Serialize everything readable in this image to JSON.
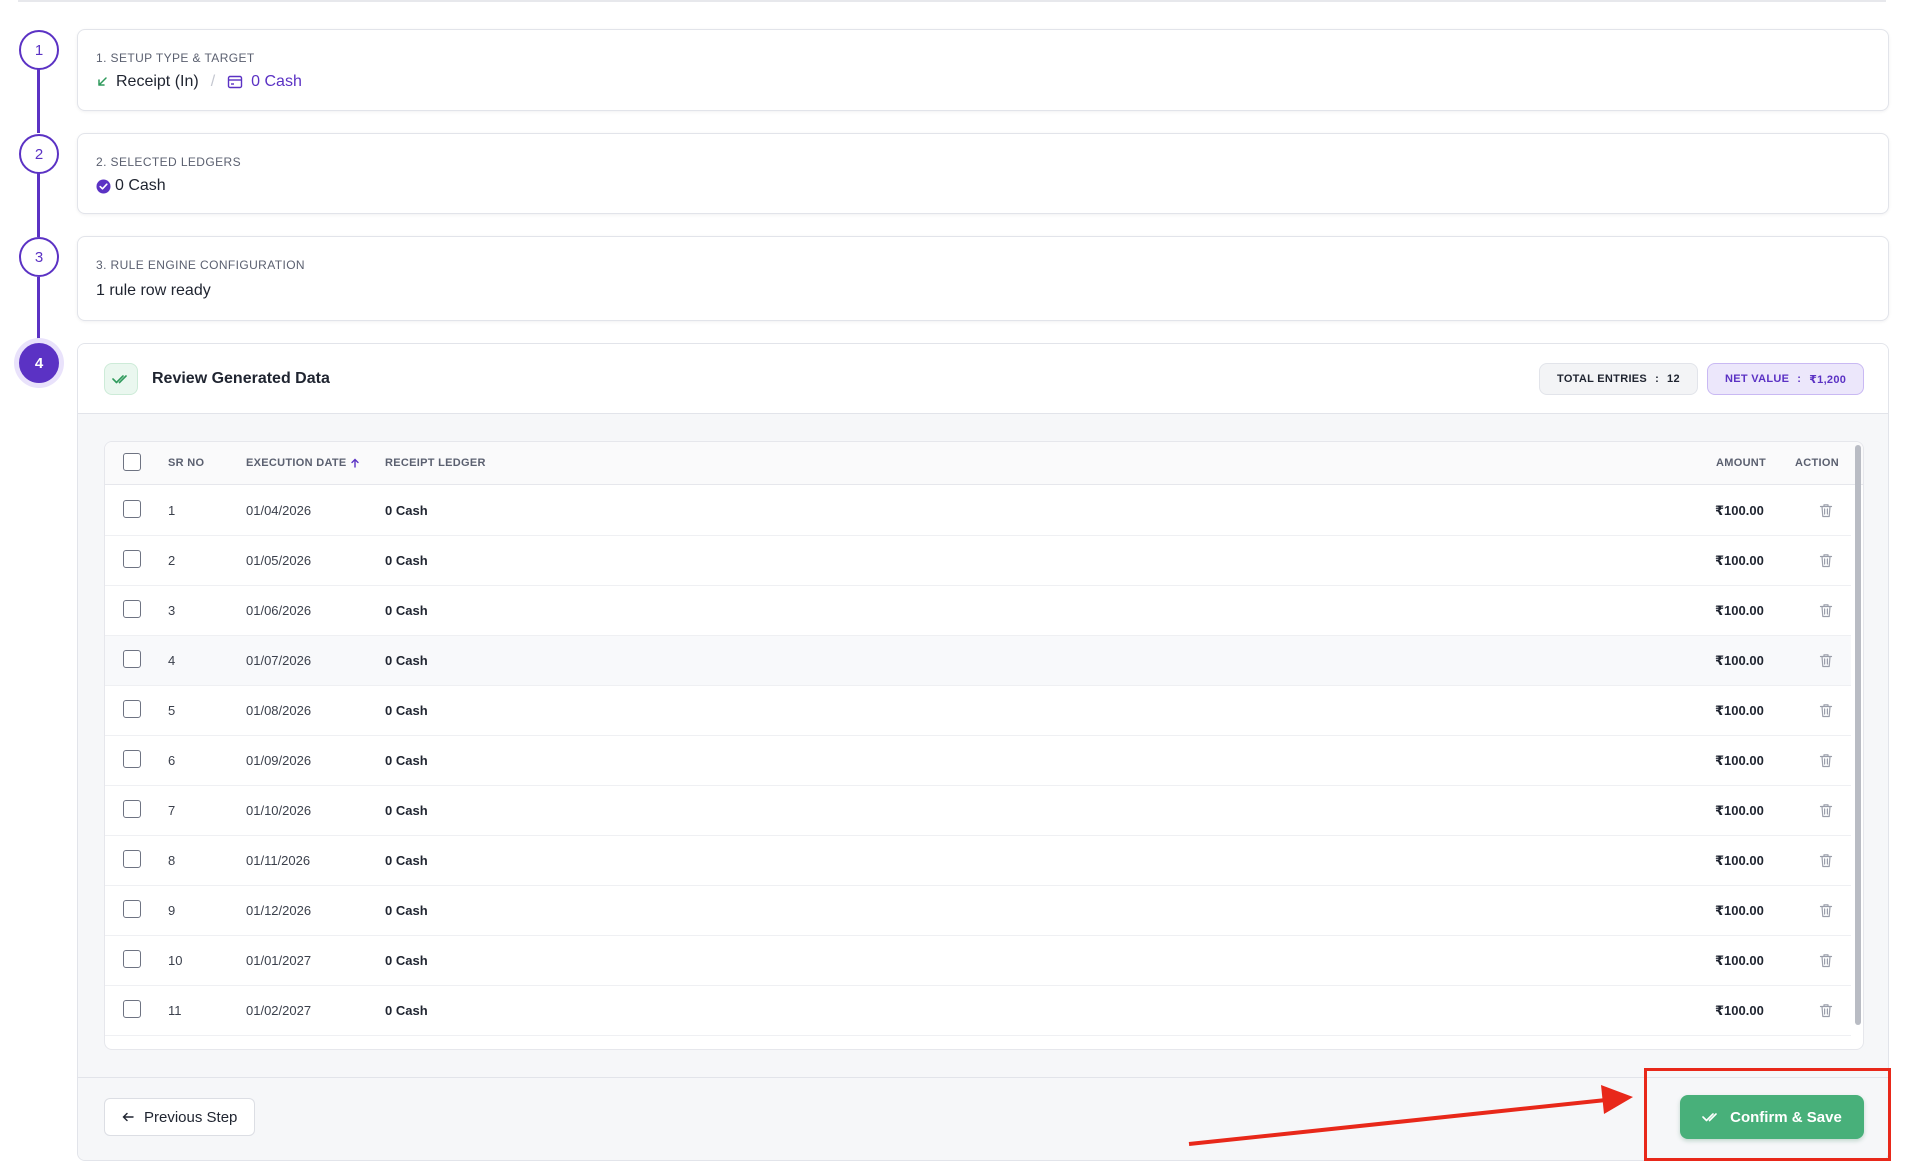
{
  "steps": [
    {
      "number": "1",
      "label": "1. SETUP TYPE & TARGET",
      "type": "Receipt (In)",
      "target": "0 Cash"
    },
    {
      "number": "2",
      "label": "2. SELECTED LEDGERS",
      "ledger": "0 Cash"
    },
    {
      "number": "3",
      "label": "3. RULE ENGINE CONFIGURATION",
      "status": "1 rule row ready"
    },
    {
      "number": "4"
    }
  ],
  "review": {
    "title": "Review Generated Data",
    "total_label": "TOTAL ENTRIES",
    "total_value": "12",
    "net_label": "NET VALUE",
    "net_value": "₹1,200"
  },
  "table": {
    "columns": {
      "sr": "SR NO",
      "date": "EXECUTION DATE",
      "ledger": "RECEIPT LEDGER",
      "amount": "AMOUNT",
      "action": "ACTION"
    },
    "rows": [
      {
        "sr": "1",
        "date": "01/04/2026",
        "ledger": "0 Cash",
        "amount": "₹100.00"
      },
      {
        "sr": "2",
        "date": "01/05/2026",
        "ledger": "0 Cash",
        "amount": "₹100.00"
      },
      {
        "sr": "3",
        "date": "01/06/2026",
        "ledger": "0 Cash",
        "amount": "₹100.00"
      },
      {
        "sr": "4",
        "date": "01/07/2026",
        "ledger": "0 Cash",
        "amount": "₹100.00"
      },
      {
        "sr": "5",
        "date": "01/08/2026",
        "ledger": "0 Cash",
        "amount": "₹100.00"
      },
      {
        "sr": "6",
        "date": "01/09/2026",
        "ledger": "0 Cash",
        "amount": "₹100.00"
      },
      {
        "sr": "7",
        "date": "01/10/2026",
        "ledger": "0 Cash",
        "amount": "₹100.00"
      },
      {
        "sr": "8",
        "date": "01/11/2026",
        "ledger": "0 Cash",
        "amount": "₹100.00"
      },
      {
        "sr": "9",
        "date": "01/12/2026",
        "ledger": "0 Cash",
        "amount": "₹100.00"
      },
      {
        "sr": "10",
        "date": "01/01/2027",
        "ledger": "0 Cash",
        "amount": "₹100.00"
      },
      {
        "sr": "11",
        "date": "01/02/2027",
        "ledger": "0 Cash",
        "amount": "₹100.00"
      }
    ]
  },
  "footer": {
    "prev_label": "Previous Step",
    "save_label": "Confirm & Save"
  },
  "colors": {
    "accent": "#5b32c4",
    "success": "#48b07a",
    "annotation": "#e8281a"
  }
}
